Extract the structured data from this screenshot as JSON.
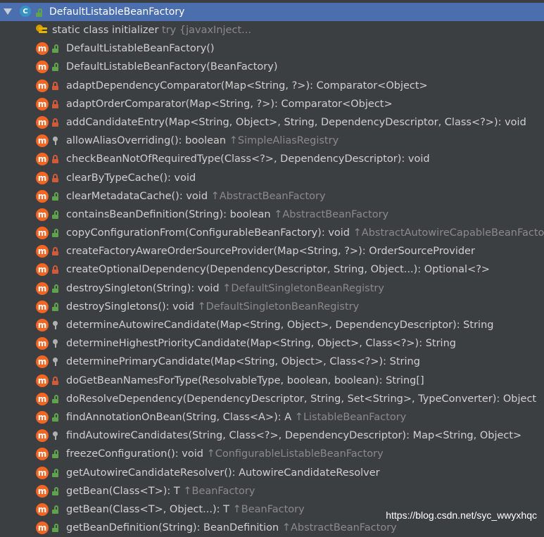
{
  "header": {
    "title": "DefaultListableBeanFactory",
    "class_icon_letter": "C"
  },
  "static_init": {
    "name": "static class initializer",
    "hint": "try {javaxInject..."
  },
  "methods": [
    {
      "vis": "public",
      "sig": "DefaultListableBeanFactory()",
      "inh": ""
    },
    {
      "vis": "public",
      "sig": "DefaultListableBeanFactory(BeanFactory)",
      "inh": ""
    },
    {
      "vis": "private",
      "sig": "adaptDependencyComparator(Map<String, ?>): Comparator<Object>",
      "inh": ""
    },
    {
      "vis": "private",
      "sig": "adaptOrderComparator(Map<String, ?>): Comparator<Object>",
      "inh": ""
    },
    {
      "vis": "private",
      "sig": "addCandidateEntry(Map<String, Object>, String, DependencyDescriptor, Class<?>): void",
      "inh": ""
    },
    {
      "vis": "protected",
      "sig": "allowAliasOverriding(): boolean ",
      "inh": "↑SimpleAliasRegistry"
    },
    {
      "vis": "private",
      "sig": "checkBeanNotOfRequiredType(Class<?>, DependencyDescriptor): void",
      "inh": ""
    },
    {
      "vis": "private",
      "sig": "clearByTypeCache(): void",
      "inh": ""
    },
    {
      "vis": "public",
      "sig": "clearMetadataCache(): void ",
      "inh": "↑AbstractBeanFactory"
    },
    {
      "vis": "public",
      "sig": "containsBeanDefinition(String): boolean ",
      "inh": "↑AbstractBeanFactory"
    },
    {
      "vis": "public",
      "sig": "copyConfigurationFrom(ConfigurableBeanFactory): void ",
      "inh": "↑AbstractAutowireCapableBeanFacto"
    },
    {
      "vis": "private",
      "sig": "createFactoryAwareOrderSourceProvider(Map<String, ?>): OrderSourceProvider",
      "inh": ""
    },
    {
      "vis": "private",
      "sig": "createOptionalDependency(DependencyDescriptor, String, Object...): Optional<?>",
      "inh": ""
    },
    {
      "vis": "public",
      "sig": "destroySingleton(String): void ",
      "inh": "↑DefaultSingletonBeanRegistry"
    },
    {
      "vis": "public",
      "sig": "destroySingletons(): void ",
      "inh": "↑DefaultSingletonBeanRegistry"
    },
    {
      "vis": "protected",
      "sig": "determineAutowireCandidate(Map<String, Object>, DependencyDescriptor): String",
      "inh": ""
    },
    {
      "vis": "protected",
      "sig": "determineHighestPriorityCandidate(Map<String, Object>, Class<?>): String",
      "inh": ""
    },
    {
      "vis": "protected",
      "sig": "determinePrimaryCandidate(Map<String, Object>, Class<?>): String",
      "inh": ""
    },
    {
      "vis": "private",
      "sig": "doGetBeanNamesForType(ResolvableType, boolean, boolean): String[]",
      "inh": ""
    },
    {
      "vis": "public",
      "sig": "doResolveDependency(DependencyDescriptor, String, Set<String>, TypeConverter): Object",
      "inh": ""
    },
    {
      "vis": "public",
      "sig": "findAnnotationOnBean(String, Class<A>): A ",
      "inh": "↑ListableBeanFactory"
    },
    {
      "vis": "protected",
      "sig": "findAutowireCandidates(String, Class<?>, DependencyDescriptor): Map<String, Object>",
      "inh": ""
    },
    {
      "vis": "public",
      "sig": "freezeConfiguration(): void ",
      "inh": "↑ConfigurableListableBeanFactory"
    },
    {
      "vis": "public",
      "sig": "getAutowireCandidateResolver(): AutowireCandidateResolver",
      "inh": ""
    },
    {
      "vis": "public",
      "sig": "getBean(Class<T>): T ",
      "inh": "↑BeanFactory"
    },
    {
      "vis": "public",
      "sig": "getBean(Class<T>, Object...): T ",
      "inh": "↑BeanFactory"
    },
    {
      "vis": "public",
      "sig": "getBeanDefinition(String): BeanDefinition ",
      "inh": "↑AbstractBeanFactory"
    }
  ],
  "watermark": "https://blog.csdn.net/syc_wwyxhqc"
}
